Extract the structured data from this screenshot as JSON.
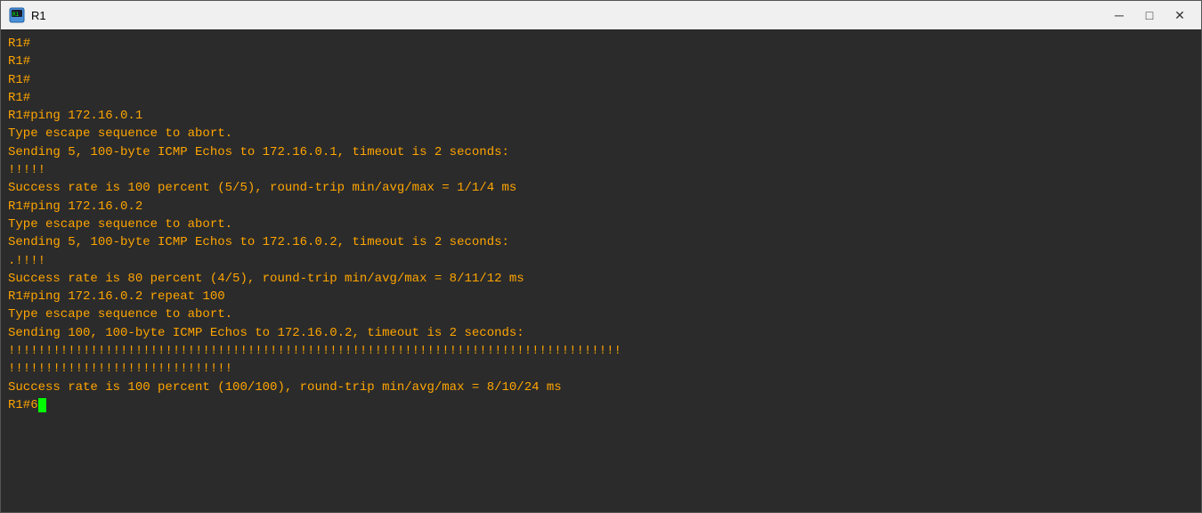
{
  "window": {
    "title": "R1",
    "icon": "🖥"
  },
  "titlebar": {
    "minimize_label": "─",
    "maximize_label": "□",
    "close_label": "✕"
  },
  "terminal": {
    "lines": [
      "R1#",
      "R1#",
      "R1#",
      "R1#",
      "R1#ping 172.16.0.1",
      "",
      "Type escape sequence to abort.",
      "Sending 5, 100-byte ICMP Echos to 172.16.0.1, timeout is 2 seconds:",
      "!!!!!",
      "Success rate is 100 percent (5/5), round-trip min/avg/max = 1/1/4 ms",
      "R1#ping 172.16.0.2",
      "",
      "Type escape sequence to abort.",
      "Sending 5, 100-byte ICMP Echos to 172.16.0.2, timeout is 2 seconds:",
      ".!!!!",
      "Success rate is 80 percent (4/5), round-trip min/avg/max = 8/11/12 ms",
      "R1#ping 172.16.0.2 repeat 100",
      "",
      "Type escape sequence to abort.",
      "Sending 100, 100-byte ICMP Echos to 172.16.0.2, timeout is 2 seconds:",
      "!!!!!!!!!!!!!!!!!!!!!!!!!!!!!!!!!!!!!!!!!!!!!!!!!!!!!!!!!!!!!!!!!!!!!!!!!!!!!!!!!!",
      "!!!!!!!!!!!!!!!!!!!!!!!!!!!!!!",
      "Success rate is 100 percent (100/100), round-trip min/avg/max = 8/10/24 ms",
      "R1#6"
    ],
    "cursor_line_index": 24,
    "cursor_after_text": "R1#6"
  }
}
